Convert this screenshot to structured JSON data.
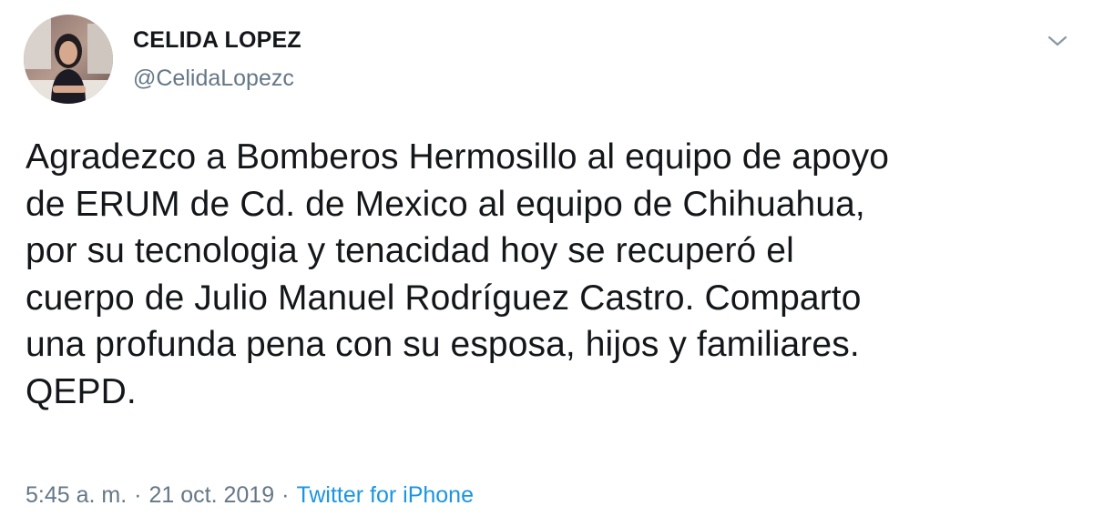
{
  "author": {
    "display_name": "CELIDA LOPEZ",
    "handle": "@CelidaLopezc",
    "avatar_icon": "profile-photo"
  },
  "menu": {
    "icon": "chevron-down-icon"
  },
  "tweet": {
    "lines": [
      "Agradezco a Bomberos Hermosillo al equipo de apoyo",
      "de ERUM de Cd. de Mexico al equipo de Chihuahua,",
      "por su tecnologia y tenacidad hoy se recuperó el",
      "cuerpo de Julio Manuel Rodríguez Castro. Comparto",
      "una profunda pena con su esposa, hijos y familiares.",
      "QEPD."
    ]
  },
  "meta": {
    "time": "5:45 a. m.",
    "separator": "·",
    "date": "21 oct. 2019",
    "source": "Twitter for iPhone"
  },
  "colors": {
    "text": "#14171a",
    "secondary": "#657786",
    "link": "#1b95e0"
  }
}
